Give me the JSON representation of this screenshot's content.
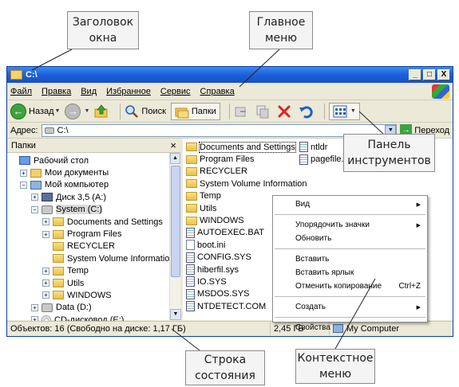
{
  "annotations": {
    "title_bar": [
      "Заголовок",
      "окна"
    ],
    "main_menu": [
      "Главное",
      "меню"
    ],
    "toolbar": [
      "Панель",
      "инструментов"
    ],
    "status_bar": [
      "Строка",
      "состояния"
    ],
    "context_menu": [
      "Контекстное",
      "меню"
    ]
  },
  "window": {
    "title": "C:\\",
    "buttons": {
      "minimize": "_",
      "maximize": "□",
      "close": "X"
    }
  },
  "menu": [
    "Файл",
    "Правка",
    "Вид",
    "Избранное",
    "Сервис",
    "Справка"
  ],
  "toolbar": {
    "back": "Назад",
    "search": "Поиск",
    "folders": "Папки"
  },
  "address": {
    "label": "Адрес:",
    "value": "C:\\",
    "go": "Переход"
  },
  "folders_pane": {
    "title": "Папки",
    "close": "×",
    "tree": [
      {
        "label": "Рабочий стол",
        "icon": "desktop-icon",
        "indent": 0,
        "expander": ""
      },
      {
        "label": "Мои документы",
        "icon": "my-documents-icon",
        "indent": 1,
        "expander": "+"
      },
      {
        "label": "Мой компьютер",
        "icon": "my-computer-icon",
        "indent": 1,
        "expander": "−"
      },
      {
        "label": "Диск 3,5 (A:)",
        "icon": "floppy-icon",
        "indent": 2,
        "expander": "+"
      },
      {
        "label": "System (C:)",
        "icon": "hard-drive-icon",
        "indent": 2,
        "expander": "−",
        "selected": true
      },
      {
        "label": "Documents and Settings",
        "icon": "folder-icon",
        "indent": 3,
        "expander": "+"
      },
      {
        "label": "Program Files",
        "icon": "folder-icon",
        "indent": 3,
        "expander": "+"
      },
      {
        "label": "RECYCLER",
        "icon": "folder-icon",
        "indent": 3,
        "expander": ""
      },
      {
        "label": "System Volume Information",
        "icon": "folder-icon",
        "indent": 3,
        "expander": ""
      },
      {
        "label": "Temp",
        "icon": "folder-icon",
        "indent": 3,
        "expander": "+"
      },
      {
        "label": "Utils",
        "icon": "folder-icon",
        "indent": 3,
        "expander": "+"
      },
      {
        "label": "WINDOWS",
        "icon": "folder-icon",
        "indent": 3,
        "expander": "+"
      },
      {
        "label": "Data (D:)",
        "icon": "hard-drive-icon",
        "indent": 2,
        "expander": "+"
      },
      {
        "label": "CD-дисковод (E:)",
        "icon": "cd-drive-icon",
        "indent": 2,
        "expander": "+"
      }
    ]
  },
  "files": {
    "col1": [
      {
        "name": "Documents and Settings",
        "icon": "folder-icon",
        "focused": true
      },
      {
        "name": "Program Files",
        "icon": "folder-icon"
      },
      {
        "name": "RECYCLER",
        "icon": "folder-icon"
      },
      {
        "name": "System Volume Information",
        "icon": "folder-icon"
      },
      {
        "name": "Temp",
        "icon": "folder-icon"
      },
      {
        "name": "Utils",
        "icon": "folder-icon"
      },
      {
        "name": "WINDOWS",
        "icon": "folder-icon"
      },
      {
        "name": "AUTOEXEC.BAT",
        "icon": "batch-file-icon"
      },
      {
        "name": "boot.ini",
        "icon": "ini-file-icon"
      },
      {
        "name": "CONFIG.SYS",
        "icon": "system-file-icon"
      },
      {
        "name": "hiberfil.sys",
        "icon": "system-file-icon"
      },
      {
        "name": "IO.SYS",
        "icon": "system-file-icon"
      },
      {
        "name": "MSDOS.SYS",
        "icon": "system-file-icon"
      },
      {
        "name": "NTDETECT.COM",
        "icon": "system-file-icon"
      }
    ],
    "col2": [
      {
        "name": "ntldr",
        "icon": "system-file-icon"
      },
      {
        "name": "pagefile.",
        "icon": "system-file-icon"
      }
    ]
  },
  "status": {
    "objects": "Объектов: 16 (Свободно на диске: 1,17 ГБ)",
    "size": "2,45 ГБ",
    "location": "My Computer"
  },
  "context_menu": {
    "groups": [
      [
        {
          "label": "Вид",
          "submenu": true
        }
      ],
      [
        {
          "label": "Упорядочить значки",
          "submenu": true
        },
        {
          "label": "Обновить"
        }
      ],
      [
        {
          "label": "Вставить"
        },
        {
          "label": "Вставить ярлык"
        },
        {
          "label": "Отменить копирование",
          "shortcut": "Ctrl+Z"
        }
      ],
      [
        {
          "label": "Создать",
          "submenu": true
        }
      ],
      [
        {
          "label": "Свойства"
        }
      ]
    ]
  },
  "colors": {
    "titlebar": "#1d5fd8",
    "window_face": "#ece9d8",
    "delete_red": "#e02020",
    "go_green": "#3ea33e"
  }
}
